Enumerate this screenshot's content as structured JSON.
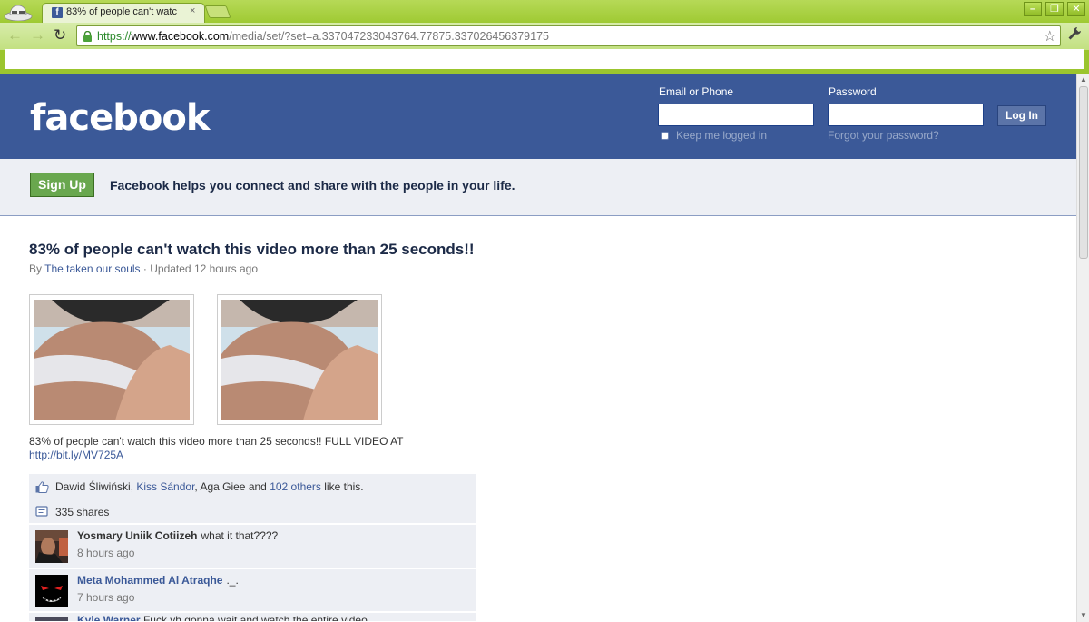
{
  "browser": {
    "tab_title": "83% of people can't watc",
    "tab_close": "×",
    "url_scheme": "https://",
    "url_host": "www.facebook.com",
    "url_path": "/media/set/?set=a.337047233043764.77875.337026456379175",
    "favicon": "f",
    "minimize": "–",
    "restore": "❐",
    "close": "✕",
    "back": "←",
    "forward": "→",
    "reload": "↻",
    "star": "☆",
    "wrench": "🔧"
  },
  "header": {
    "logo": "facebook",
    "email_label": "Email or Phone",
    "password_label": "Password",
    "keep_logged_in": "Keep me logged in",
    "forgot_password": "Forgot your password?",
    "login_button": "Log In"
  },
  "signup": {
    "button": "Sign Up",
    "tagline": "Facebook helps you connect and share with the people in your life."
  },
  "post": {
    "title": "83% of people can't watch this video more than 25 seconds!!",
    "by": "By",
    "author": "The taken our souls",
    "separator": "·",
    "updated": "Updated 12 hours ago",
    "caption": "83% of people can't watch this video more than 25 seconds!! FULL VIDEO AT",
    "link": "http://bit.ly/MV725A"
  },
  "likes": {
    "name1": "Dawid Śliwiński",
    "comma": ",",
    "name2": "Kiss Sándor",
    "name3": "Aga Giee",
    "and": "and",
    "others": "102 others",
    "suffix": "like this."
  },
  "shares": {
    "label": "335 shares"
  },
  "comments": [
    {
      "author": "Yosmary Uniik Cotiizeh",
      "text": "what it that????",
      "time": "8 hours ago"
    },
    {
      "author": "Meta Mohammed Al Atraqhe",
      "text": "._.",
      "time": "7 hours ago"
    },
    {
      "author": "Kyle Warner",
      "text": "Fuck yh gonna wait and watch the entire video..."
    }
  ],
  "icons": {
    "like": "thumbs-up-icon",
    "share": "share-icon"
  },
  "colors": {
    "facebook_blue": "#3b5998",
    "signup_green": "#69a74e",
    "chrome_green": "#9bc52e"
  }
}
